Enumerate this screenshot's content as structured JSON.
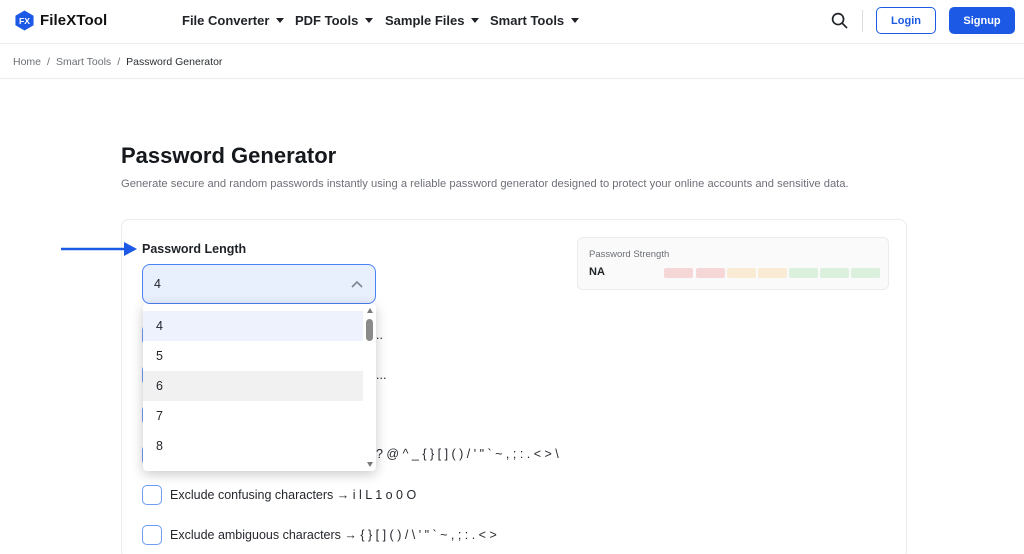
{
  "brand": {
    "name": "FileXTool",
    "logo_text": "FX",
    "accent": "#1c5ae6"
  },
  "nav": {
    "items": [
      "File Converter",
      "PDF Tools",
      "Sample Files",
      "Smart Tools"
    ],
    "login": "Login",
    "signup": "Signup"
  },
  "breadcrumb": {
    "items": [
      "Home",
      "Smart Tools",
      "Password Generator"
    ],
    "separator": "/"
  },
  "page": {
    "title": "Password Generator",
    "description": "Generate secure and random passwords instantly using a reliable password generator designed to protect your online accounts and sensitive data."
  },
  "generator": {
    "length_label": "Password Length",
    "length_value": "4",
    "length_options": [
      "4",
      "5",
      "6",
      "7",
      "8"
    ],
    "strength_label": "Password Strength",
    "strength_value": "NA",
    "strength_colors": [
      "#f6d7d7",
      "#f6d7d7",
      "#faecd4",
      "#faecd4",
      "#dcf0de",
      "#dcf0de",
      "#dcf0de"
    ]
  },
  "options": {
    "row1_tail": "..",
    "row2_tail": "...",
    "row4_tail": "? @ ^ _ { } [ ] ( ) / ' \" ` ~ , ; : . < > \\",
    "exclude_confusing": "Exclude confusing characters → i l L 1 o 0 O",
    "exclude_ambiguous": "Exclude ambiguous characters → { } [ ] ( ) / \\ ' \" ` ~ , ; : . < >"
  },
  "icons": {
    "search": "search-icon",
    "chevron": "chevron-up-icon",
    "arrow": "arrow-right-icon"
  }
}
